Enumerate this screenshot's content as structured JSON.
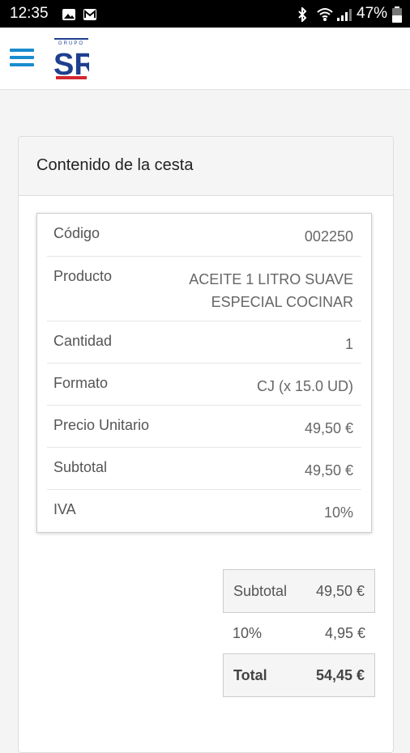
{
  "status": {
    "time": "12:35",
    "battery": "47%"
  },
  "app": {
    "logo_text": "SR",
    "logo_caption": "GRUPO"
  },
  "cart": {
    "title": "Contenido de la cesta",
    "rows": [
      {
        "label": "Código",
        "value": "002250"
      },
      {
        "label": "Producto",
        "value": "ACEITE 1 LITRO SUAVE ESPECIAL COCINAR"
      },
      {
        "label": "Cantidad",
        "value": "1"
      },
      {
        "label": "Formato",
        "value": "CJ (x 15.0 UD)"
      },
      {
        "label": "Precio Unitario",
        "value": "49,50 €"
      },
      {
        "label": "Subtotal",
        "value": "49,50 €"
      },
      {
        "label": "IVA",
        "value": "10%"
      }
    ],
    "totals": {
      "subtotal_label": "Subtotal",
      "subtotal_value": "49,50 €",
      "tax_label": "10%",
      "tax_value": "4,95 €",
      "total_label": "Total",
      "total_value": "54,45 €"
    }
  },
  "colors": {
    "accent": "#1a8ccf",
    "logo_blue": "#1f3f8f",
    "logo_red": "#d32630"
  }
}
